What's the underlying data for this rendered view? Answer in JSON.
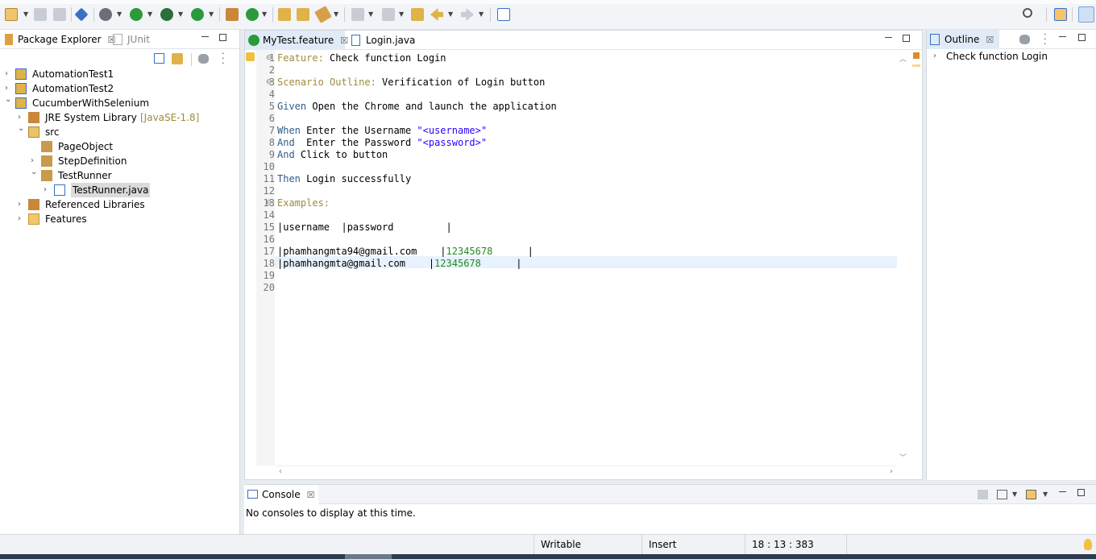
{
  "toolbar": {
    "icons": [
      "new-icon",
      "save-icon",
      "save-all-icon",
      "skip-breakpoints-icon",
      "debug-icon",
      "run-icon",
      "run-external-icon",
      "coverage-icon",
      "new-package-icon",
      "new-class-icon",
      "open-type-icon",
      "open-task-icon",
      "search-icon",
      "next-annotation-icon",
      "previous-annotation-icon",
      "last-edit-icon",
      "back-icon",
      "forward-icon",
      "pin-editor-icon",
      "quick-access-search-icon",
      "open-perspective-icon",
      "java-perspective-icon"
    ]
  },
  "package_explorer": {
    "tabs": [
      {
        "label": "Package Explorer",
        "active": true
      },
      {
        "label": "JUnit",
        "active": false
      }
    ],
    "tree": [
      {
        "label": "AutomationTest1",
        "icon": "project-icon",
        "expanded": false,
        "depth": 0
      },
      {
        "label": "AutomationTest2",
        "icon": "project-icon",
        "expanded": false,
        "depth": 0
      },
      {
        "label": "CucumberWithSelenium",
        "icon": "project-icon",
        "expanded": true,
        "depth": 0
      },
      {
        "label": "JRE System Library",
        "decoration": "[JavaSE-1.8]",
        "icon": "library-icon",
        "expanded": false,
        "depth": 1
      },
      {
        "label": "src",
        "icon": "source-folder-icon",
        "expanded": true,
        "depth": 1
      },
      {
        "label": "PageObject",
        "icon": "package-icon",
        "expanded": null,
        "depth": 2
      },
      {
        "label": "StepDefinition",
        "icon": "package-icon",
        "expanded": false,
        "depth": 2
      },
      {
        "label": "TestRunner",
        "icon": "package-icon",
        "expanded": true,
        "depth": 2
      },
      {
        "label": "TestRunner.java",
        "icon": "java-file-icon",
        "expanded": false,
        "depth": 3,
        "selected": true
      },
      {
        "label": "Referenced Libraries",
        "icon": "library-icon",
        "expanded": false,
        "depth": 1
      },
      {
        "label": "Features",
        "icon": "folder-icon",
        "expanded": false,
        "depth": 1
      }
    ]
  },
  "editor": {
    "tabs": [
      {
        "label": "MyTest.feature",
        "active": true
      },
      {
        "label": "Login.java",
        "active": false
      }
    ],
    "lines": [
      {
        "n": "1",
        "fold": true,
        "parts": [
          {
            "t": "Feature:",
            "c": "kw"
          },
          {
            "t": " Check function Login",
            "c": ""
          }
        ]
      },
      {
        "n": "2",
        "parts": []
      },
      {
        "n": "3",
        "fold": true,
        "parts": [
          {
            "t": "Scenario Outline:",
            "c": "kw"
          },
          {
            "t": " Verification of Login button",
            "c": ""
          }
        ]
      },
      {
        "n": "4",
        "parts": []
      },
      {
        "n": "5",
        "parts": [
          {
            "t": "Given",
            "c": "step"
          },
          {
            "t": " Open the Chrome and launch the application",
            "c": ""
          }
        ]
      },
      {
        "n": "6",
        "parts": []
      },
      {
        "n": "7",
        "parts": [
          {
            "t": "When",
            "c": "step"
          },
          {
            "t": " Enter the Username ",
            "c": ""
          },
          {
            "t": "\"<username>\"",
            "c": "str"
          }
        ]
      },
      {
        "n": "8",
        "parts": [
          {
            "t": "And",
            "c": "step"
          },
          {
            "t": "  Enter the Password ",
            "c": ""
          },
          {
            "t": "\"<password>\"",
            "c": "str"
          }
        ]
      },
      {
        "n": "9",
        "parts": [
          {
            "t": "And",
            "c": "step"
          },
          {
            "t": " Click to button",
            "c": ""
          }
        ]
      },
      {
        "n": "10",
        "parts": []
      },
      {
        "n": "11",
        "parts": [
          {
            "t": "Then",
            "c": "step"
          },
          {
            "t": " Login successfully",
            "c": ""
          }
        ]
      },
      {
        "n": "12",
        "parts": []
      },
      {
        "n": "13",
        "fold": true,
        "parts": [
          {
            "t": "Examples:",
            "c": "kw"
          }
        ]
      },
      {
        "n": "14",
        "parts": []
      },
      {
        "n": "15",
        "parts": [
          {
            "t": "|username  |password         |",
            "c": ""
          }
        ]
      },
      {
        "n": "16",
        "parts": []
      },
      {
        "n": "17",
        "parts": [
          {
            "t": "|phamhangmta94@gmail.com    |",
            "c": ""
          },
          {
            "t": "12345678",
            "c": "num"
          },
          {
            "t": "      |",
            "c": ""
          }
        ]
      },
      {
        "n": "18",
        "parts": [
          {
            "t": "|phamhangmta@gmail.com    |",
            "c": ""
          },
          {
            "t": "12345678",
            "c": "num"
          },
          {
            "t": "      |",
            "c": ""
          }
        ]
      },
      {
        "n": "19",
        "parts": []
      },
      {
        "n": "20",
        "parts": []
      }
    ]
  },
  "outline": {
    "tab_label": "Outline",
    "items": [
      {
        "label": "Check function Login"
      }
    ]
  },
  "console": {
    "tab_label": "Console",
    "message": "No consoles to display at this time."
  },
  "status": {
    "writable": "Writable",
    "insert_mode": "Insert",
    "position": "18 : 13 : 383"
  }
}
